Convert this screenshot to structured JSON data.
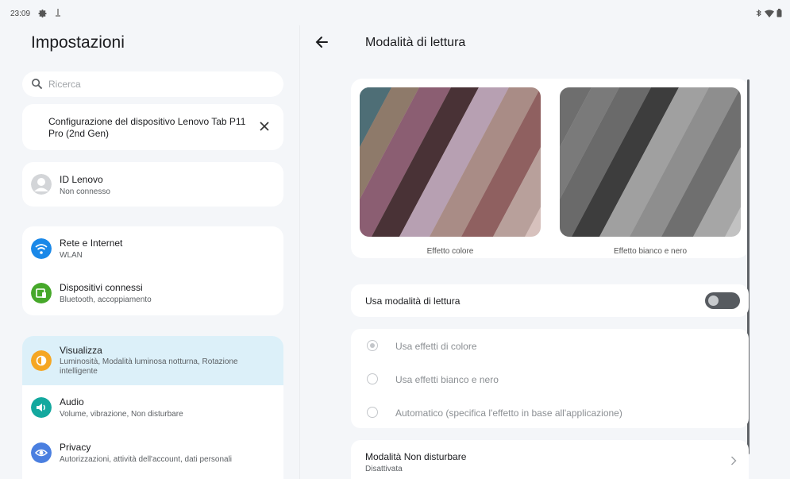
{
  "status_bar": {
    "time": "23:09"
  },
  "left": {
    "title": "Impostazioni",
    "search_placeholder": "Ricerca",
    "setup_card": {
      "text": "Configurazione del dispositivo Lenovo Tab P11 Pro (2nd Gen)"
    },
    "lenovo_id": {
      "title": "ID Lenovo",
      "subtitle": "Non connesso"
    },
    "items": [
      {
        "title": "Rete e Internet",
        "subtitle": "WLAN",
        "icon": "wifi-icon",
        "color": "#1a88e8"
      },
      {
        "title": "Dispositivi connessi",
        "subtitle": "Bluetooth, accoppiamento",
        "icon": "devices-icon",
        "color": "#46a82a"
      },
      {
        "title": "Visualizza",
        "subtitle": "Luminosità, Modalità luminosa notturna, Rotazione intelligente",
        "icon": "display-icon",
        "color": "#f5a623"
      },
      {
        "title": "Audio",
        "subtitle": "Volume, vibrazione, Non disturbare",
        "icon": "volume-icon",
        "color": "#13a89e"
      },
      {
        "title": "Privacy",
        "subtitle": "Autorizzazioni, attività dell'account, dati personali",
        "icon": "privacy-icon",
        "color": "#4a7fe0"
      }
    ]
  },
  "right": {
    "title": "Modalità di lettura",
    "preview": {
      "color_caption": "Effetto colore",
      "bw_caption": "Effetto bianco e nero"
    },
    "toggle": {
      "label": "Usa modalità di lettura",
      "enabled": false
    },
    "radio_options": [
      {
        "label": "Usa effetti di colore",
        "checked": true
      },
      {
        "label": "Usa effetti bianco e nero",
        "checked": false
      },
      {
        "label": "Automatico (specifica l'effetto in base all'applicazione)",
        "checked": false
      }
    ],
    "dnd": {
      "title": "Modalità Non disturbare",
      "subtitle": "Disattivata"
    }
  }
}
